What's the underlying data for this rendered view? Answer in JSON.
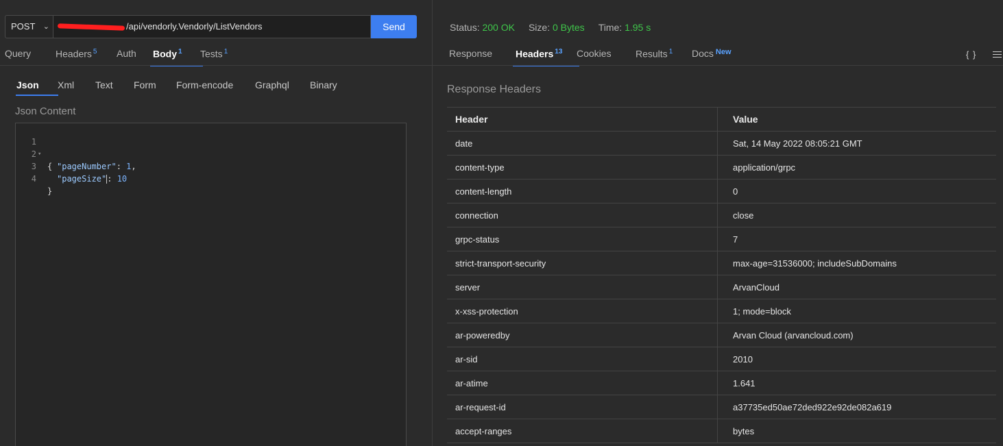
{
  "request": {
    "method": "POST",
    "url_visible": "/api/vendorly.Vendorly/ListVendors",
    "send_label": "Send",
    "tabs": [
      {
        "label": "Query",
        "badge": ""
      },
      {
        "label": "Headers",
        "badge": "5"
      },
      {
        "label": "Auth",
        "badge": ""
      },
      {
        "label": "Body",
        "badge": "1",
        "active": true
      },
      {
        "label": "Tests",
        "badge": "1"
      }
    ],
    "body_tabs": [
      "Json",
      "Xml",
      "Text",
      "Form",
      "Form-encode",
      "Graphql",
      "Binary"
    ],
    "content_label": "Json Content",
    "code_lines": [
      {
        "num": "1",
        "text": "{"
      },
      {
        "num": "2",
        "key": "\"pageNumber\"",
        "value": "1",
        "suffix": ","
      },
      {
        "num": "3",
        "key": "\"pageSize\"",
        "value": "10",
        "suffix": ""
      },
      {
        "num": "4",
        "text": "}"
      }
    ]
  },
  "response": {
    "status_label": "Status:",
    "status_value": "200 OK",
    "size_label": "Size:",
    "size_value": "0 Bytes",
    "time_label": "Time:",
    "time_value": "1.95 s",
    "tabs": [
      {
        "label": "Response",
        "badge": ""
      },
      {
        "label": "Headers",
        "badge": "13",
        "active": true
      },
      {
        "label": "Cookies",
        "badge": ""
      },
      {
        "label": "Results",
        "badge": "1"
      },
      {
        "label": "Docs",
        "badge": "New"
      }
    ],
    "braces_icon": "{ }",
    "section_title": "Response Headers",
    "table": {
      "columns": [
        "Header",
        "Value"
      ],
      "rows": [
        [
          "date",
          "Sat, 14 May 2022 08:05:21 GMT"
        ],
        [
          "content-type",
          "application/grpc"
        ],
        [
          "content-length",
          "0"
        ],
        [
          "connection",
          "close"
        ],
        [
          "grpc-status",
          "7"
        ],
        [
          "strict-transport-security",
          "max-age=31536000; includeSubDomains"
        ],
        [
          "server",
          "ArvanCloud"
        ],
        [
          "x-xss-protection",
          "1; mode=block"
        ],
        [
          "ar-poweredby",
          "Arvan Cloud (arvancloud.com)"
        ],
        [
          "ar-sid",
          "2010"
        ],
        [
          "ar-atime",
          "1.641"
        ],
        [
          "ar-request-id",
          "a37735ed50ae72ded922e92de082a619"
        ],
        [
          "accept-ranges",
          "bytes"
        ]
      ]
    }
  },
  "colors": {
    "accent": "#3d7ef0",
    "status_ok": "#3fc64a",
    "redaction": "#ff1f1f"
  }
}
